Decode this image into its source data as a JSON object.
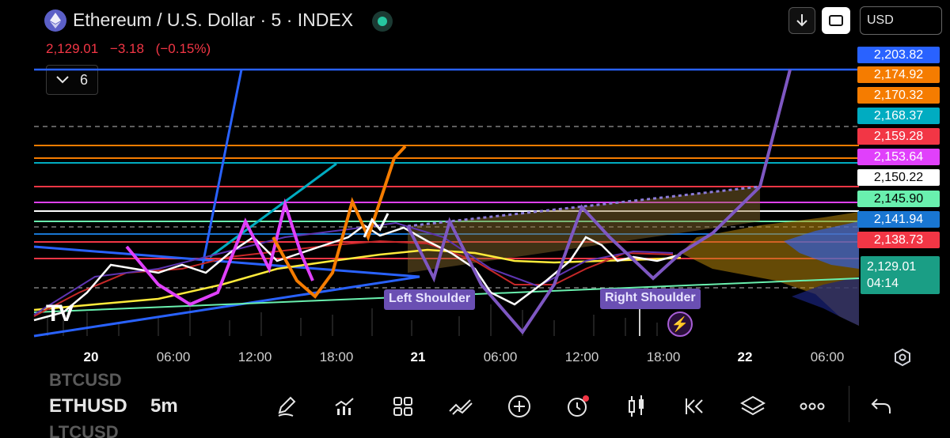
{
  "header": {
    "title": "Ethereum / U.S. Dollar · 5 · INDEX",
    "last_price": "2,129.01",
    "change": "−3.18",
    "change_percent": "(−0.15%)",
    "currency": "USD"
  },
  "indicators": {
    "count": "6"
  },
  "price_labels": [
    {
      "value": "2,203.82",
      "color": "#2962ff",
      "text": "#ffffff"
    },
    {
      "value": "2,174.92",
      "color": "#f57c00",
      "text": "#ffffff"
    },
    {
      "value": "2,170.32",
      "color": "#f57c00",
      "text": "#ffffff"
    },
    {
      "value": "2,168.37",
      "color": "#00acc1",
      "text": "#ffffff"
    },
    {
      "value": "2,159.28",
      "color": "#f23645",
      "text": "#ffffff"
    },
    {
      "value": "2,153.64",
      "color": "#e040fb",
      "text": "#ffffff"
    },
    {
      "value": "2,150.22",
      "color": "#ffffff",
      "text": "#000000"
    },
    {
      "value": "2,145.90",
      "color": "#69f0ae",
      "text": "#000000"
    },
    {
      "value": "2,141.94",
      "color": "#1976d2",
      "text": "#ffffff"
    },
    {
      "value": "2,138.73",
      "color": "#f23645",
      "text": "#ffffff"
    }
  ],
  "current_price": {
    "value": "2,129.01",
    "countdown": "04:14",
    "color": "#1a9e85"
  },
  "annotations": {
    "left": "Left Shoulder",
    "right": "Right Shoulder"
  },
  "time_axis": [
    {
      "label": "20",
      "bold": true
    },
    {
      "label": "06:00",
      "bold": false
    },
    {
      "label": "12:00",
      "bold": false
    },
    {
      "label": "18:00",
      "bold": false
    },
    {
      "label": "21",
      "bold": true
    },
    {
      "label": "06:00",
      "bold": false
    },
    {
      "label": "12:00",
      "bold": false
    },
    {
      "label": "18:00",
      "bold": false
    },
    {
      "label": "22",
      "bold": true
    },
    {
      "label": "06:00",
      "bold": false
    }
  ],
  "bottom": {
    "symbol_above": "BTCUSD",
    "symbol": "ETHUSD",
    "symbol_below": "LTCUSD",
    "timeframe": "5m"
  },
  "tools": [
    "pencil-icon",
    "indicators-icon",
    "grid-icon",
    "trend-icon",
    "add-icon",
    "alert-icon",
    "candles-icon",
    "replay-icon",
    "layers-icon",
    "more-icon",
    "undo-icon"
  ]
}
